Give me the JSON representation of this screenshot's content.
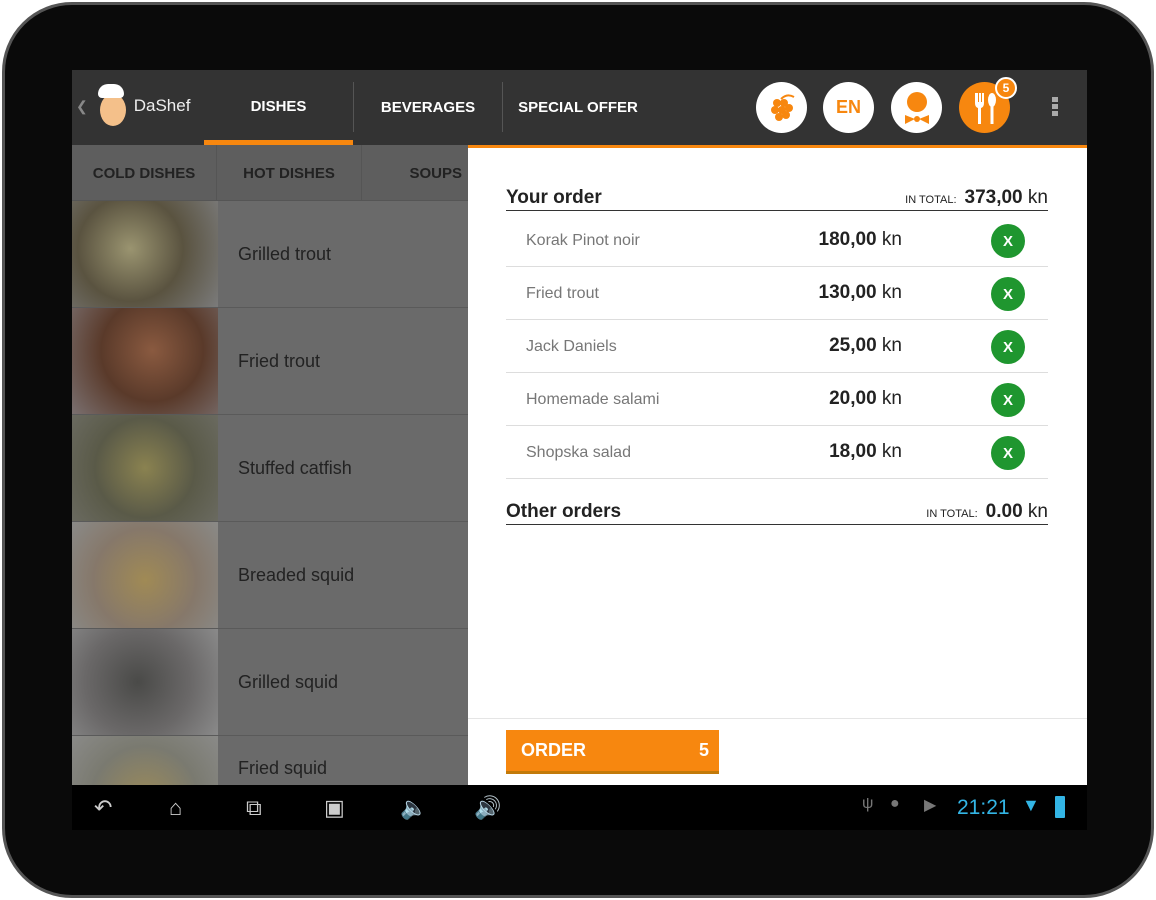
{
  "app": {
    "name": "DaShef"
  },
  "tabs": [
    {
      "label": "DISHES",
      "active": true
    },
    {
      "label": "BEVERAGES"
    },
    {
      "label": "SPECIAL OFFER"
    }
  ],
  "toolbar": {
    "language": "EN",
    "cart_count": "5",
    "icons": [
      "grapes-icon",
      "language-icon",
      "waiter-icon",
      "cutlery-icon",
      "overflow-menu-icon"
    ]
  },
  "subtabs": [
    "COLD DISHES",
    "HOT DISHES",
    "SOUPS"
  ],
  "dishes": [
    {
      "name": "Grilled trout"
    },
    {
      "name": "Fried trout"
    },
    {
      "name": "Stuffed catfish"
    },
    {
      "name": "Breaded squid"
    },
    {
      "name": "Grilled squid"
    },
    {
      "name": "Fried squid"
    }
  ],
  "your_order": {
    "title": "Your order",
    "total_label": "IN TOTAL:",
    "total_value": "373,00",
    "currency": "kn",
    "items": [
      {
        "name": "Korak Pinot noir",
        "price": "180,00",
        "currency": "kn",
        "remove": "X"
      },
      {
        "name": "Fried trout",
        "price": "130,00",
        "currency": "kn",
        "remove": "X"
      },
      {
        "name": "Jack Daniels",
        "price": "25,00",
        "currency": "kn",
        "remove": "X"
      },
      {
        "name": "Homemade salami",
        "price": "20,00",
        "currency": "kn",
        "remove": "X"
      },
      {
        "name": "Shopska salad",
        "price": "18,00",
        "currency": "kn",
        "remove": "X"
      }
    ]
  },
  "other_orders": {
    "title": "Other orders",
    "total_label": "IN TOTAL:",
    "total_value": "0.00",
    "currency": "kn"
  },
  "order_button": {
    "label": "ORDER",
    "count": "5"
  },
  "status_bar": {
    "time": "21:21"
  },
  "colors": {
    "accent": "#f7870f",
    "remove": "#1f962f",
    "clock": "#33b5e5"
  }
}
